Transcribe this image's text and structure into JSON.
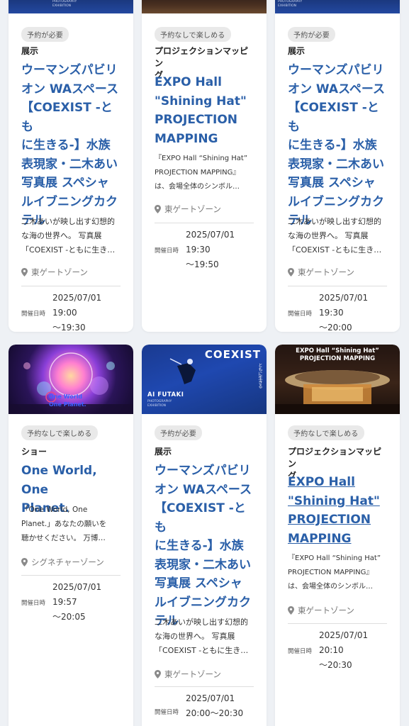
{
  "cards": [
    {
      "badge": "予約が必要",
      "category": "展示",
      "title_lines": [
        "ウーマンズパビリ",
        "オン WAスペース",
        "【COEXIST -とも",
        "に生きる-】水族",
        "表現家・二木あい",
        "写真展 スペシャ",
        "ルイブニングカク",
        "テル"
      ],
      "desc_lines": [
        "二木あいが映し出す幻想的",
        "な海の世界へ。 写真展",
        "「COEXIST -ともに生き…"
      ],
      "location": "東ゲートゾーン",
      "date_label": "開催日時",
      "date_lines": [
        "2025/07/01 19:00",
        "～19:30"
      ]
    },
    {
      "badge": "予約なしで楽しめる",
      "category_lines": [
        "プロジェクションマッピン",
        "グ"
      ],
      "title_lines": [
        "EXPO Hall",
        "\"Shining Hat\"",
        "PROJECTION",
        "MAPPING"
      ],
      "desc_lines": [
        "『EXPO Hall “Shining Hat”",
        "PROJECTION MAPPING』",
        "は、会場全体のシンボル…"
      ],
      "location": "東ゲートゾーン",
      "date_label": "開催日時",
      "date_lines": [
        "2025/07/01 19:30",
        "～19:50"
      ]
    },
    {
      "badge": "予約が必要",
      "category": "展示",
      "title_lines": [
        "ウーマンズパビリ",
        "オン WAスペース",
        "【COEXIST -とも",
        "に生きる-】水族",
        "表現家・二木あい",
        "写真展 スペシャ",
        "ルイブニングカク",
        "テル"
      ],
      "desc_lines": [
        "二木あいが映し出す幻想的",
        "な海の世界へ。 写真展",
        "「COEXIST -ともに生き…"
      ],
      "location": "東ゲートゾーン",
      "date_label": "開催日時",
      "date_lines": [
        "2025/07/01 19:30",
        "～20:00"
      ]
    },
    {
      "badge": "予約なしで楽しめる",
      "category": "ショー",
      "title_lines": [
        "One World, One",
        "Planet."
      ],
      "desc_lines": [
        "「One World, One",
        "Planet.」あなたの願いを",
        "聴かせください。 万博…"
      ],
      "location": "シグネチャーゾーン",
      "date_label": "開催日時",
      "date_lines": [
        "2025/07/01 19:57",
        "～20:05"
      ],
      "image_text": [
        "One World",
        "One Planet."
      ]
    },
    {
      "badge": "予約が必要",
      "category": "展示",
      "title_lines": [
        "ウーマンズパビリ",
        "オン WAスペース",
        "【COEXIST -とも",
        "に生きる-】水族",
        "表現家・二木あい",
        "写真展 スペシャ",
        "ルイブニングカク",
        "テル"
      ],
      "desc_lines": [
        "二木あいが映し出す幻想的",
        "な海の世界へ。 写真展",
        "「COEXIST -ともに生き…"
      ],
      "location": "東ゲートゾーン",
      "date_label": "開催日時",
      "date_lines": [
        "2025/07/01",
        "20:00～20:30"
      ],
      "image_text": [
        "COEXIST",
        "ともに生きる",
        "AI FUTAKI",
        "PHOTOGRAPHY",
        "EXHIBITION"
      ]
    },
    {
      "badge": "予約なしで楽しめる",
      "category_lines": [
        "プロジェクションマッピン",
        "グ"
      ],
      "title_lines": [
        "EXPO Hall",
        "\"Shining Hat\"",
        "PROJECTION",
        "MAPPING"
      ],
      "desc_lines": [
        "『EXPO Hall “Shining Hat”",
        "PROJECTION MAPPING』",
        "は、会場全体のシンボル…"
      ],
      "location": "東ゲートゾーン",
      "date_label": "開催日時",
      "date_lines": [
        "2025/07/01 20:10",
        "～20:30"
      ],
      "image_text": [
        "EXPO Hall “Shining Hat”",
        "PROJECTION MAPPING"
      ]
    }
  ],
  "top_image_text": [
    "PHOTOGRAPHY",
    "EXHIBITION"
  ],
  "colors": {
    "title": "#2a5fa8",
    "badge_bg": "#e9e9e9",
    "page_bg": "#eef1f5"
  }
}
